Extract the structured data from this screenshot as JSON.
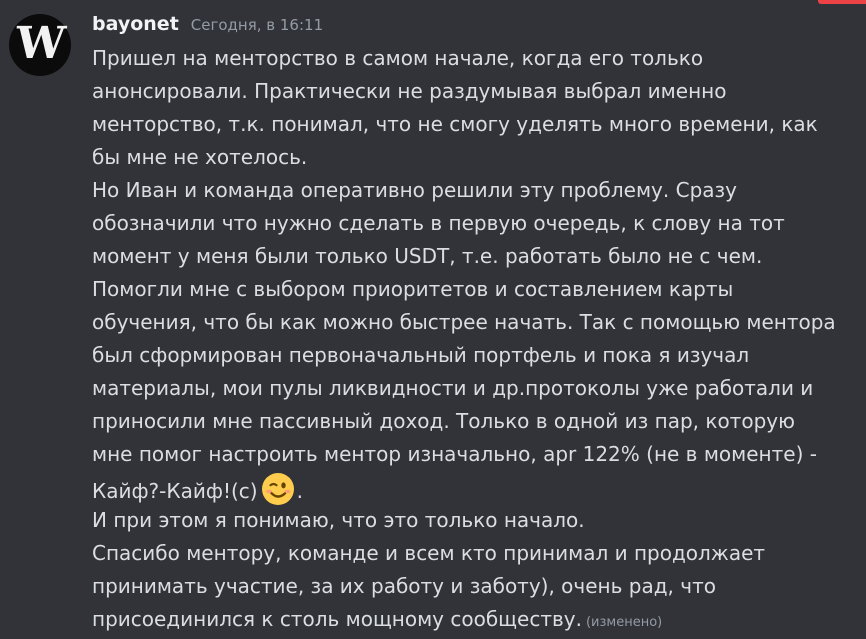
{
  "colors": {
    "background": "#313338",
    "text": "#dbdee1",
    "username": "#f2f3f5",
    "muted": "#949ba4",
    "avatar_bg": "#0b0b0b",
    "top_edge_accent": "#ed4245"
  },
  "message": {
    "author": {
      "avatar_text": "W",
      "username": "bayonet"
    },
    "timestamp": "Сегодня, в 16:11",
    "lines": [
      "Пришел на менторство в самом начале, когда его только",
      "анонсировали. Практически не раздумывая выбрал именно",
      "менторство, т.к. понимал, что не смогу уделять много времени, как",
      "бы мне не хотелось.",
      "Но Иван и команда оперативно решили эту проблему. Сразу",
      "обозначили что нужно сделать в первую очередь, к слову на тот",
      "момент у меня были только USDT, т.е. работать было не с чем.",
      "Помогли мне с выбором приоритетов и составлением карты",
      "обучения, что бы как можно быстрее начать. Так с помощью ментора",
      "был сформирован первоначальный портфель и пока я изучал",
      "материалы, мои пулы ликвидности и др.протоколы уже работали и",
      "приносили мне пассивный доход. Только в одной из пар, которую",
      "мне помог настроить ментор изначально, apr 122% (не в моменте) -"
    ],
    "emoji_line": {
      "before": "Кайф?-Кайф!(с)",
      "emoji": "winking-face",
      "after": "."
    },
    "closing_lines": [
      "И при этом я понимаю, что это только начало.",
      "Спасибо ментору, команде и всем кто принимал и продолжает",
      "принимать участие, за их работу и заботу), очень рад, что"
    ],
    "last_line": "присоединился к столь мощному сообществу.",
    "edited_label": "(изменено)"
  }
}
